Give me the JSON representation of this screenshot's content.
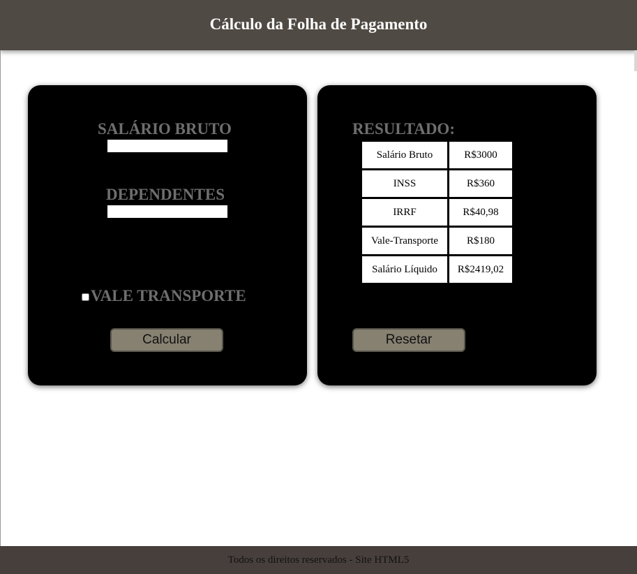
{
  "header": {
    "title": "Cálculo da Folha de Pagamento"
  },
  "form": {
    "salary_label": "SALÁRIO BRUTO",
    "salary_value": "",
    "dependents_label": "DEPENDENTES",
    "dependents_value": "",
    "transport_label": "VALE TRANSPORTE",
    "transport_checked": false,
    "calculate_label": "Calcular"
  },
  "result": {
    "title": "RESULTADO:",
    "rows": [
      {
        "label": "Salário Bruto",
        "value": "R$3000"
      },
      {
        "label": "INSS",
        "value": "R$360"
      },
      {
        "label": "IRRF",
        "value": "R$40,98"
      },
      {
        "label": "Vale-Transporte",
        "value": "R$180"
      },
      {
        "label": "Salário Líquido",
        "value": "R$2419,02"
      }
    ],
    "reset_label": "Resetar"
  },
  "footer": {
    "text": "Todos os direitos reservados - Site HTML5"
  },
  "colors": {
    "header_bg": "#4f4a43",
    "panel_bg": "#000000",
    "label_gray": "#6e6e6e",
    "button_bg": "#868171",
    "footer_bg": "#473f3c"
  }
}
